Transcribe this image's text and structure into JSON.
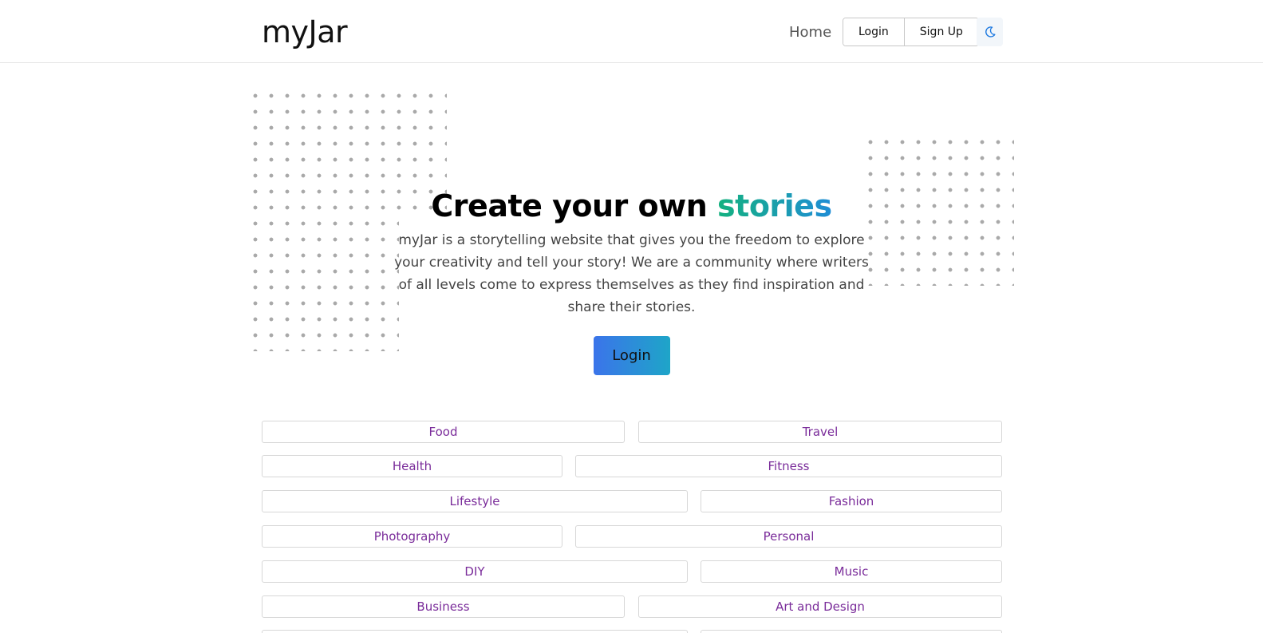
{
  "brand": "myJar",
  "nav": {
    "home": "Home",
    "login": "Login",
    "signup": "Sign Up",
    "theme_icon": "moon-icon"
  },
  "hero": {
    "title_main": "Create your own ",
    "title_accent": "stories",
    "description": "myJar is a storytelling website that gives you the freedom to explore your creativity and tell your story! We are a community where writers of all levels come to express themselves as they find inspiration and share their stories.",
    "login_button": "Login"
  },
  "categories": [
    "Food",
    "Travel",
    "Health",
    "Fitness",
    "Lifestyle",
    "Fashion",
    "Photography",
    "Personal",
    "DIY",
    "Music",
    "Business",
    "Art and Design"
  ],
  "colors": {
    "accent_green": "#14b17f",
    "accent_blue": "#1f8dd6",
    "category_text": "#7a2c9a",
    "button_gradient_start": "#3b74ea",
    "button_gradient_end": "#1ea5c8"
  }
}
